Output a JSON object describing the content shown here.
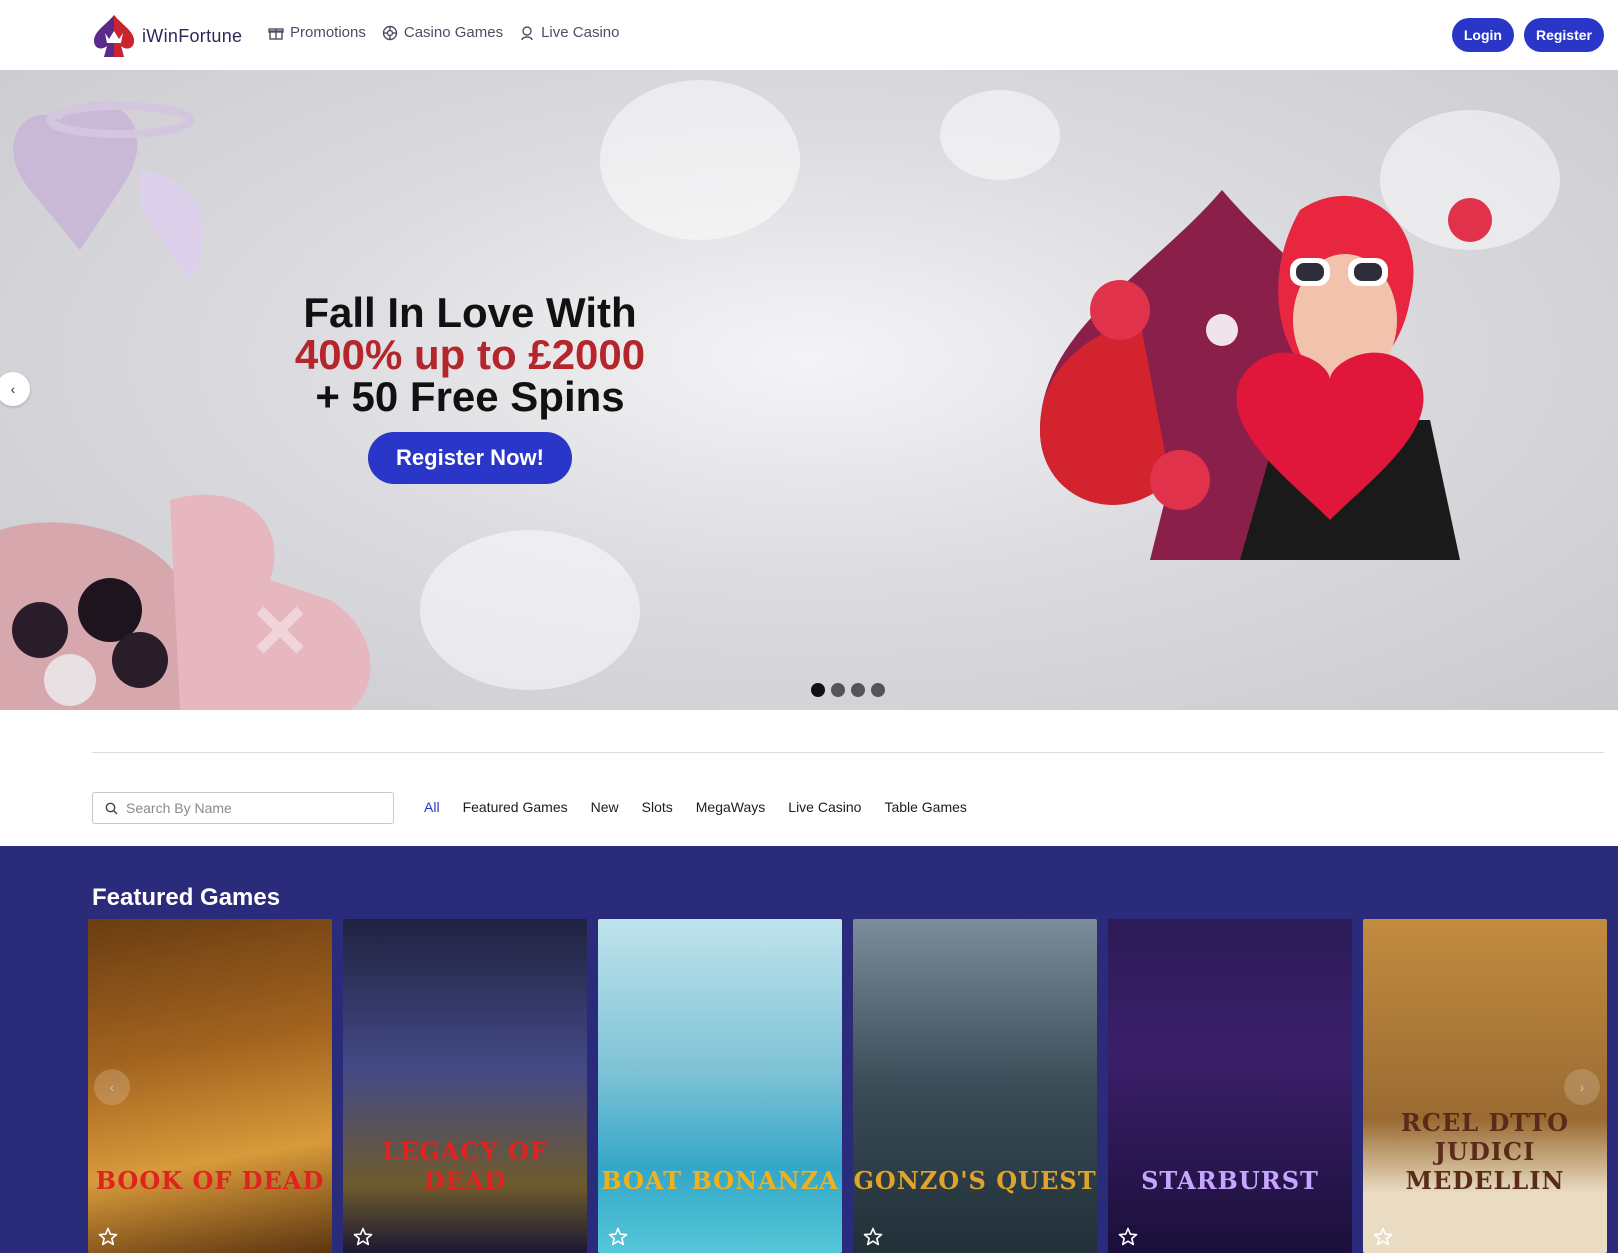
{
  "header": {
    "brand": "iWinFortune",
    "nav": [
      {
        "label": "Promotions",
        "icon": "gift-icon"
      },
      {
        "label": "Casino Games",
        "icon": "chip-icon"
      },
      {
        "label": "Live Casino",
        "icon": "dealer-icon"
      }
    ],
    "login_label": "Login",
    "register_label": "Register"
  },
  "hero": {
    "line1": "Fall In Love With",
    "line2": "400% up to £2000",
    "line3": "+ 50 Free Spins",
    "cta_label": "Register Now!",
    "prev_icon": "‹",
    "slide_count": 4,
    "active_slide": 1
  },
  "search": {
    "placeholder": "Search By Name"
  },
  "filters": [
    "All",
    "Featured Games",
    "New",
    "Slots",
    "MegaWays",
    "Live Casino",
    "Table Games"
  ],
  "active_filter": "All",
  "featured": {
    "title": "Featured Games",
    "games": [
      {
        "name": "BOOK OF DEAD",
        "name_color": "#e0231f"
      },
      {
        "name": "LEGACY OF DEAD",
        "name_color": "#e0231f"
      },
      {
        "name": "BOAT BONANZA",
        "name_color": "#f2b11b"
      },
      {
        "name": "GONZO'S QUEST",
        "name_color": "#e0a42d"
      },
      {
        "name": "STARBURST",
        "name_color": "#c7a6ff"
      },
      {
        "name": "RCEL DTTO JUDICI MEDELLIN",
        "name_color": "#5a2b19"
      }
    ]
  },
  "colors": {
    "brand_blue": "#2a36c7",
    "featured_bg": "#2b2b7c",
    "hero_red": "#b4252c"
  }
}
